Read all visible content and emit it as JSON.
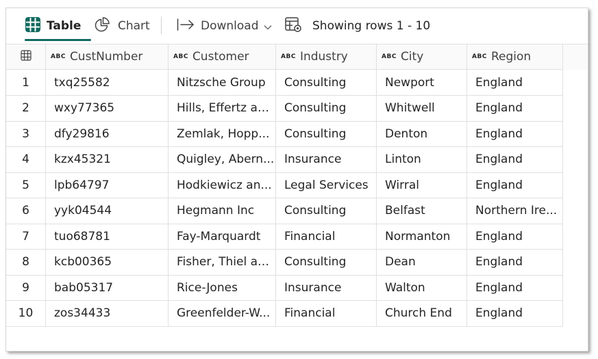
{
  "toolbar": {
    "table_label": "Table",
    "chart_label": "Chart",
    "download_label": "Download",
    "rows_label": "Showing rows 1 - 10"
  },
  "colors": {
    "accent": "#0f6a5e",
    "border": "#e0e0e0"
  },
  "columns": [
    {
      "type": "ABC",
      "label": "CustNumber"
    },
    {
      "type": "ABC",
      "label": "Customer"
    },
    {
      "type": "ABC",
      "label": "Industry"
    },
    {
      "type": "ABC",
      "label": "City"
    },
    {
      "type": "ABC",
      "label": "Region"
    }
  ],
  "rows": [
    {
      "num": "1",
      "cells": [
        "txq25582",
        "Nitzsche Group",
        "Consulting",
        "Newport",
        "England"
      ]
    },
    {
      "num": "2",
      "cells": [
        "wxy77365",
        "Hills, Effertz an...",
        "Consulting",
        "Whitwell",
        "England"
      ]
    },
    {
      "num": "3",
      "cells": [
        "dfy29816",
        "Zemlak, Hopp...",
        "Consulting",
        "Denton",
        "England"
      ]
    },
    {
      "num": "4",
      "cells": [
        "kzx45321",
        "Quigley, Abern...",
        "Insurance",
        "Linton",
        "England"
      ]
    },
    {
      "num": "5",
      "cells": [
        "lpb64797",
        "Hodkiewicz an...",
        "Legal Services",
        "Wirral",
        "England"
      ]
    },
    {
      "num": "6",
      "cells": [
        "yyk04544",
        "Hegmann Inc",
        "Consulting",
        "Belfast",
        "Northern Ire..."
      ]
    },
    {
      "num": "7",
      "cells": [
        "tuo68781",
        "Fay-Marquardt",
        "Financial",
        "Normanton",
        "England"
      ]
    },
    {
      "num": "8",
      "cells": [
        "kcb00365",
        "Fisher, Thiel an...",
        "Consulting",
        "Dean",
        "England"
      ]
    },
    {
      "num": "9",
      "cells": [
        "bab05317",
        "Rice-Jones",
        "Insurance",
        "Walton",
        "England"
      ]
    },
    {
      "num": "10",
      "cells": [
        "zos34433",
        "Greenfelder-W...",
        "Financial",
        "Church End",
        "England"
      ]
    }
  ],
  "icons": {
    "table": "table-grid-icon",
    "chart": "pie-chart-icon",
    "download": "arrow-to-bar-icon",
    "rows": "table-settings-icon",
    "header": "grid-icon"
  }
}
